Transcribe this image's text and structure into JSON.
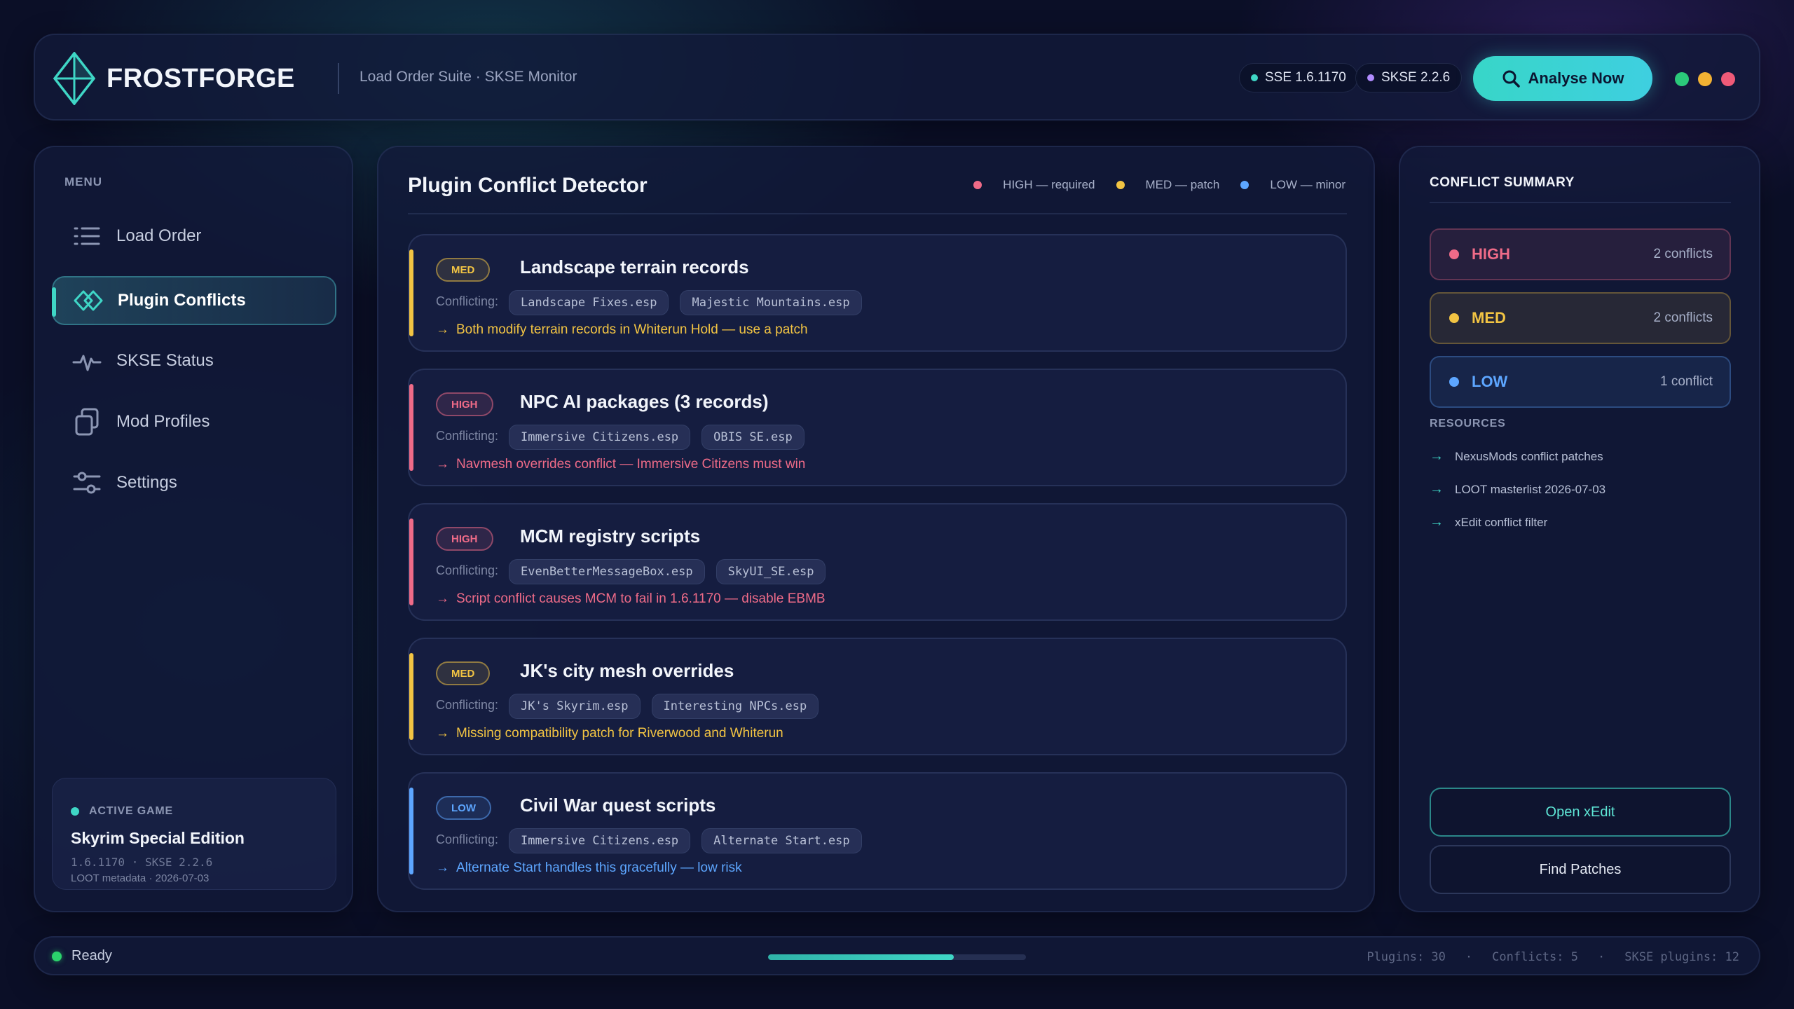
{
  "header": {
    "logo_text": "FROSTFORGE",
    "subtitle": "Load Order Suite · SKSE Monitor",
    "chips": [
      {
        "label": "SSE 1.6.1170",
        "color": "#3fd6c6"
      },
      {
        "label": "SKSE 2.2.6",
        "color": "#b18cff"
      }
    ],
    "analyse_label": "Analyse Now",
    "window_dots": [
      "#2bc97a",
      "#f2b233",
      "#ef5a78"
    ]
  },
  "sidebar": {
    "menu_label": "MENU",
    "items": [
      {
        "label": "Load Order",
        "icon": "list-icon",
        "active": false
      },
      {
        "label": "Plugin Conflicts",
        "icon": "diamond-link-icon",
        "active": true
      },
      {
        "label": "SKSE Status",
        "icon": "pulse-icon",
        "active": false
      },
      {
        "label": "Mod Profiles",
        "icon": "copy-icon",
        "active": false
      },
      {
        "label": "Settings",
        "icon": "sliders-icon",
        "active": false
      }
    ],
    "active_game": {
      "label": "ACTIVE GAME",
      "name": "Skyrim Special Edition",
      "version": "1.6.1170  ·  SKSE 2.2.6",
      "meta": "LOOT metadata · 2026-07-03"
    }
  },
  "main": {
    "title": "Plugin Conflict Detector",
    "legend": [
      {
        "label": "HIGH — required",
        "color": "#ef6b88"
      },
      {
        "label": "MED — patch",
        "color": "#f2c443"
      },
      {
        "label": "LOW — minor",
        "color": "#5da6ff"
      }
    ],
    "conflicting_label": "Conflicting:",
    "cards": [
      {
        "severity": "MED",
        "title": "Landscape terrain records",
        "plugins": [
          "Landscape Fixes.esp",
          "Majestic Mountains.esp"
        ],
        "note": "Both modify terrain records in Whiterun Hold — use a patch"
      },
      {
        "severity": "HIGH",
        "title": "NPC AI packages (3 records)",
        "plugins": [
          "Immersive Citizens.esp",
          "OBIS SE.esp"
        ],
        "note": "Navmesh overrides conflict — Immersive Citizens must win"
      },
      {
        "severity": "HIGH",
        "title": "MCM registry scripts",
        "plugins": [
          "EvenBetterMessageBox.esp",
          "SkyUI_SE.esp"
        ],
        "note": "Script conflict causes MCM to fail in 1.6.1170 — disable EBMB"
      },
      {
        "severity": "MED",
        "title": "JK's city mesh overrides",
        "plugins": [
          "JK's Skyrim.esp",
          "Interesting NPCs.esp"
        ],
        "note": "Missing compatibility patch for Riverwood and Whiterun"
      },
      {
        "severity": "LOW",
        "title": "Civil War quest scripts",
        "plugins": [
          "Immersive Citizens.esp",
          "Alternate Start.esp"
        ],
        "note": "Alternate Start handles this gracefully — low risk"
      }
    ]
  },
  "summary": {
    "title": "CONFLICT SUMMARY",
    "severities": [
      {
        "name": "HIGH",
        "count": "2 conflicts",
        "color": "#ef6b88"
      },
      {
        "name": "MED",
        "count": "2 conflicts",
        "color": "#f2c443"
      },
      {
        "name": "LOW",
        "count": "1 conflict",
        "color": "#5da6ff"
      }
    ],
    "resources_title": "RESOURCES",
    "resources": [
      "NexusMods conflict patches",
      "LOOT masterlist 2026-07-03",
      "xEdit conflict filter"
    ],
    "open_xedit_label": "Open xEdit",
    "find_patches_label": "Find Patches"
  },
  "status": {
    "ready": "Ready",
    "progress": 0.72,
    "stats": [
      "Plugins: 30",
      "Conflicts: 5",
      "SKSE plugins: 12"
    ]
  }
}
